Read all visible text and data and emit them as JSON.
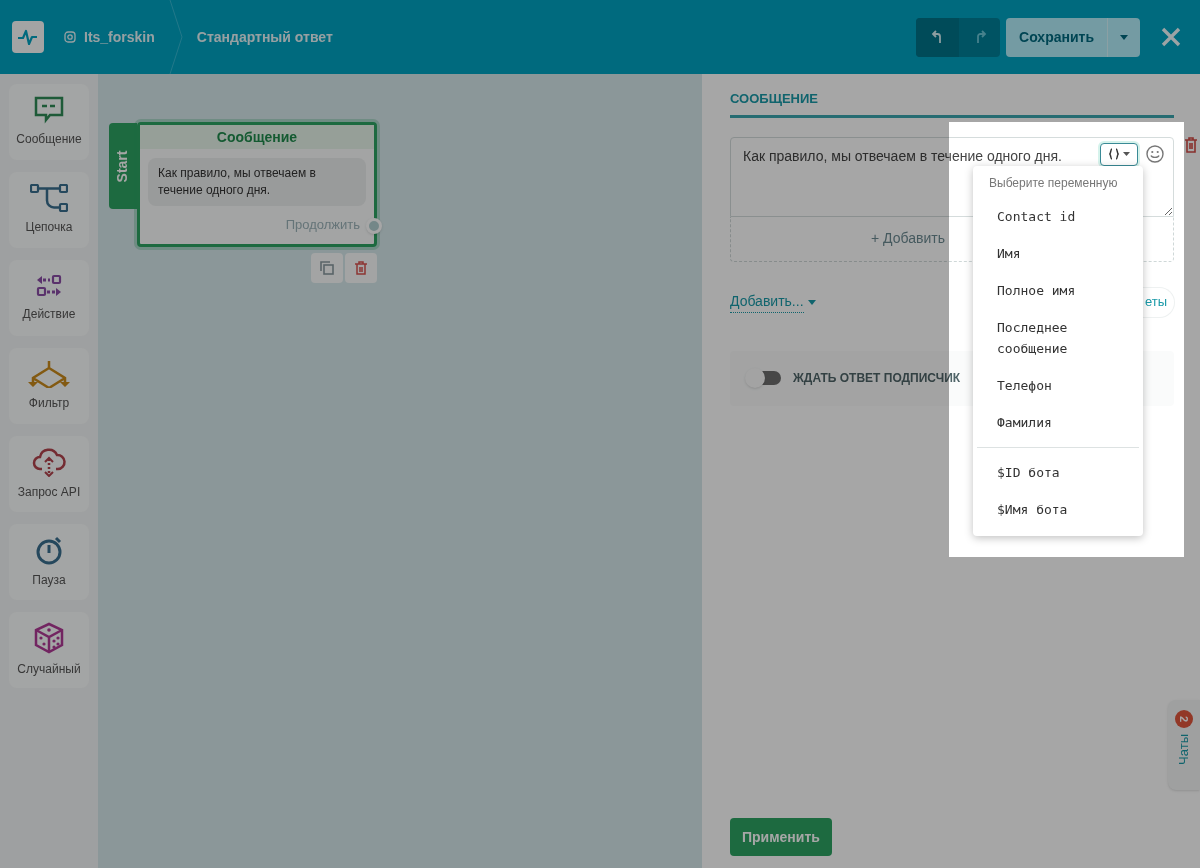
{
  "header": {
    "account": "Its_forskin",
    "breadcrumb": "Стандартный ответ",
    "save_button": "Сохранить"
  },
  "sidebar": {
    "items": [
      {
        "label": "Сообщение",
        "kind": "message"
      },
      {
        "label": "Цепочка",
        "kind": "chain"
      },
      {
        "label": "Действие",
        "kind": "action"
      },
      {
        "label": "Фильтр",
        "kind": "filter"
      },
      {
        "label": "Запрос API",
        "kind": "api"
      },
      {
        "label": "Пауза",
        "kind": "pause"
      },
      {
        "label": "Случайный",
        "kind": "random"
      }
    ]
  },
  "canvas": {
    "node": {
      "start_tab": "Start",
      "title": "Сообщение",
      "message": "Как правило, мы отвечаем в течение одного дня.",
      "continue": "Продолжить"
    }
  },
  "panel": {
    "section_title": "СООБЩЕНИЕ",
    "message_text": "Как правило, мы отвечаем в течение одного дня.",
    "add_button_text": "+ Добавить",
    "add_menu": "Добавить...",
    "quick_replies_partial": "еты",
    "wait_toggle": {
      "label": "ЖДАТЬ ОТВЕТ ПОДПИСЧИК",
      "on": false
    },
    "apply_button": "Применить"
  },
  "variable_menu": {
    "title": "Выберите переменную",
    "groups": [
      [
        "Contact id",
        "Имя",
        "Полное имя",
        "Последнее сообщение",
        "Телефон",
        "Фамилия"
      ],
      [
        "$ID бота",
        "$Имя бота"
      ]
    ]
  },
  "chats": {
    "label": "Чаты",
    "badge": "2"
  }
}
